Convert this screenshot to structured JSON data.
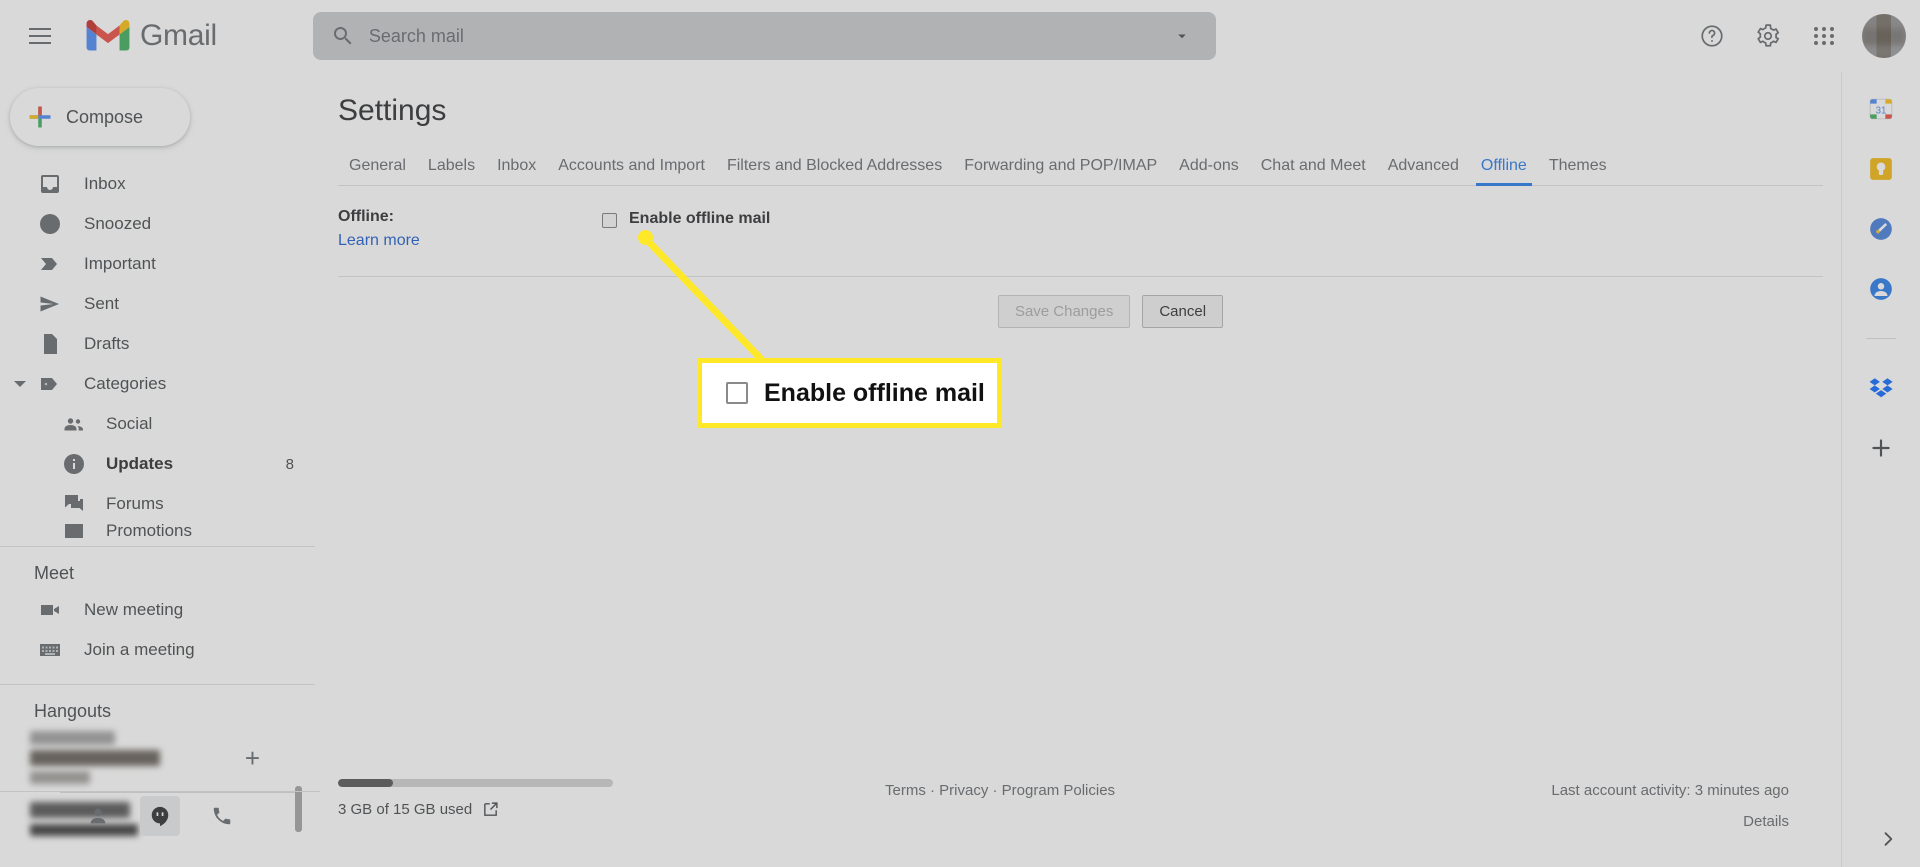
{
  "topbar": {
    "menu_icon": "hamburger-icon",
    "brand": "Gmail",
    "search": {
      "placeholder": "Search mail",
      "value": "",
      "search_icon": "search-icon",
      "options_icon": "chevron-down-icon"
    },
    "help_icon": "help-circle-icon",
    "settings_icon": "gear-icon",
    "apps_icon": "apps-grid-icon",
    "avatar": "user-avatar"
  },
  "sidebar": {
    "compose": {
      "label": "Compose",
      "icon": "plus-icon"
    },
    "items": [
      {
        "label": "Inbox",
        "icon": "inbox-icon",
        "count": "",
        "bold": false,
        "sub": false
      },
      {
        "label": "Snoozed",
        "icon": "clock-icon",
        "count": "",
        "bold": false,
        "sub": false
      },
      {
        "label": "Important",
        "icon": "important-label-icon",
        "count": "",
        "bold": false,
        "sub": false
      },
      {
        "label": "Sent",
        "icon": "send-icon",
        "count": "",
        "bold": false,
        "sub": false
      },
      {
        "label": "Drafts",
        "icon": "draft-file-icon",
        "count": "",
        "bold": false,
        "sub": false
      },
      {
        "label": "Categories",
        "icon": "tag-icon",
        "count": "",
        "bold": false,
        "sub": false,
        "expandable": true
      },
      {
        "label": "Social",
        "icon": "people-icon",
        "count": "",
        "bold": false,
        "sub": true
      },
      {
        "label": "Updates",
        "icon": "info-icon",
        "count": "8",
        "bold": true,
        "sub": true
      },
      {
        "label": "Forums",
        "icon": "forum-icon",
        "count": "",
        "bold": false,
        "sub": true
      }
    ],
    "meet": {
      "title": "Meet",
      "items": [
        {
          "label": "New meeting",
          "icon": "video-camera-icon"
        },
        {
          "label": "Join a meeting",
          "icon": "keyboard-icon"
        }
      ]
    },
    "hangouts": {
      "title": "Hangouts",
      "add_icon": "plus-icon",
      "footer_icons": [
        "person-icon",
        "hangouts-icon",
        "phone-icon"
      ]
    }
  },
  "main": {
    "page_title": "Settings",
    "tabs": [
      {
        "label": "General",
        "active": false
      },
      {
        "label": "Labels",
        "active": false
      },
      {
        "label": "Inbox",
        "active": false
      },
      {
        "label": "Accounts and Import",
        "active": false
      },
      {
        "label": "Filters and Blocked Addresses",
        "active": false
      },
      {
        "label": "Forwarding and POP/IMAP",
        "active": false
      },
      {
        "label": "Add-ons",
        "active": false
      },
      {
        "label": "Chat and Meet",
        "active": false
      },
      {
        "label": "Advanced",
        "active": false
      },
      {
        "label": "Offline",
        "active": true
      },
      {
        "label": "Themes",
        "active": false
      }
    ],
    "offline_section": {
      "label": "Offline:",
      "learn_more": "Learn more",
      "checkbox_label": "Enable offline mail",
      "checkbox_checked": false
    },
    "buttons": {
      "save": {
        "label": "Save Changes",
        "disabled": true
      },
      "cancel": {
        "label": "Cancel",
        "disabled": false
      }
    }
  },
  "footer": {
    "storage_fill_percent": 20,
    "storage_text": "3 GB of 15 GB used",
    "storage_link_icon": "external-link-icon",
    "links": "Terms · Privacy · Program Policies",
    "activity": "Last account activity: 3 minutes ago",
    "details": "Details"
  },
  "rail": {
    "icons": [
      "google-calendar-icon",
      "google-keep-icon",
      "google-tasks-icon",
      "google-contacts-icon",
      "dropbox-icon",
      "add-addon-icon"
    ],
    "expand_icon": "chevron-right-icon"
  },
  "callout": {
    "text": "Enable offline mail",
    "checkbox_name": "enable-offline-mail-checkbox",
    "highlight_color": "#ffe827"
  },
  "colors": {
    "accent_blue": "#1a73e8",
    "link_blue": "#1155cc",
    "text_primary": "#202124",
    "text_secondary": "#5f6368",
    "highlight_yellow": "#ffe827"
  }
}
